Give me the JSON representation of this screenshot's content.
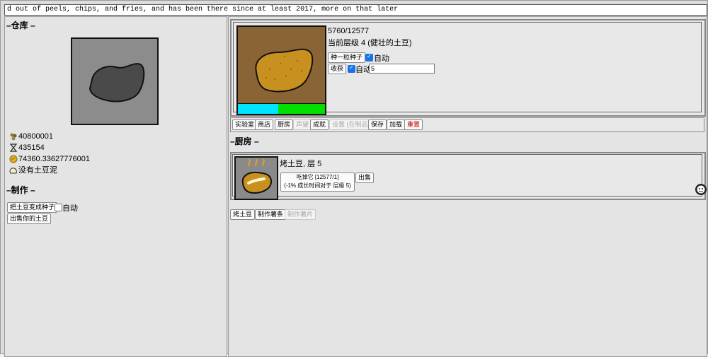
{
  "ticker_text": "d out of peels, chips, and fries, and has been there since at least 2017, more on that later",
  "warehouse": {
    "title": "–仓库 –",
    "resources": [
      {
        "icon": "seeds-icon",
        "value": "40800001"
      },
      {
        "icon": "hourglass-icon",
        "value": "435154"
      },
      {
        "icon": "coin-icon",
        "value": "74360.33627776001"
      },
      {
        "icon": "mash-icon",
        "value": "没有土豆泥"
      }
    ]
  },
  "crafting": {
    "title": "–制作 –",
    "seeds_button": "把土豆变成种子",
    "auto_label": "自动",
    "auto_checked": false,
    "sell_button": "出售你的土豆"
  },
  "field": {
    "progress": "5760/12577",
    "level_text": "当前层级 4 (健壮的土豆)",
    "plant_button": "种一粒种子",
    "plant_auto_label": "自动",
    "plant_auto_checked": true,
    "harvest_button": "收获",
    "harvest_auto_label": "自动",
    "harvest_auto_checked": true,
    "harvest_amount": "5",
    "growth_fraction": 0.46
  },
  "tabs": [
    {
      "label": "实验室",
      "disabled": false,
      "danger": false
    },
    {
      "label": "商店",
      "disabled": false,
      "danger": false
    },
    {
      "label": "厨房",
      "disabled": false,
      "danger": false
    },
    {
      "label": "声望",
      "disabled": true,
      "danger": false
    },
    {
      "label": "成就",
      "disabled": false,
      "danger": false
    },
    {
      "label": "设置 (在制品)",
      "disabled": true,
      "danger": false
    },
    {
      "label": "保存",
      "disabled": false,
      "danger": false
    },
    {
      "label": "加载",
      "disabled": false,
      "danger": false
    },
    {
      "label": "重置",
      "disabled": false,
      "danger": true
    }
  ],
  "kitchen": {
    "title": "–厨房 –",
    "item_title": "烤土豆, 层 5",
    "eat_line1": "吃掉它 [12577/1]",
    "eat_line2": "(-1% 成长时间对于 层级 5)",
    "sell_button": "出售",
    "recipe_buttons": [
      {
        "label": "烤土豆",
        "disabled": false
      },
      {
        "label": "制作薯条",
        "disabled": false
      },
      {
        "label": "制作薯片",
        "disabled": true
      }
    ]
  },
  "colors": {
    "potato": "#c8901e",
    "soil": "#8b6436",
    "progress_cyan": "#00e5ff",
    "progress_green": "#00e000",
    "stone": "#4a4a4a"
  }
}
